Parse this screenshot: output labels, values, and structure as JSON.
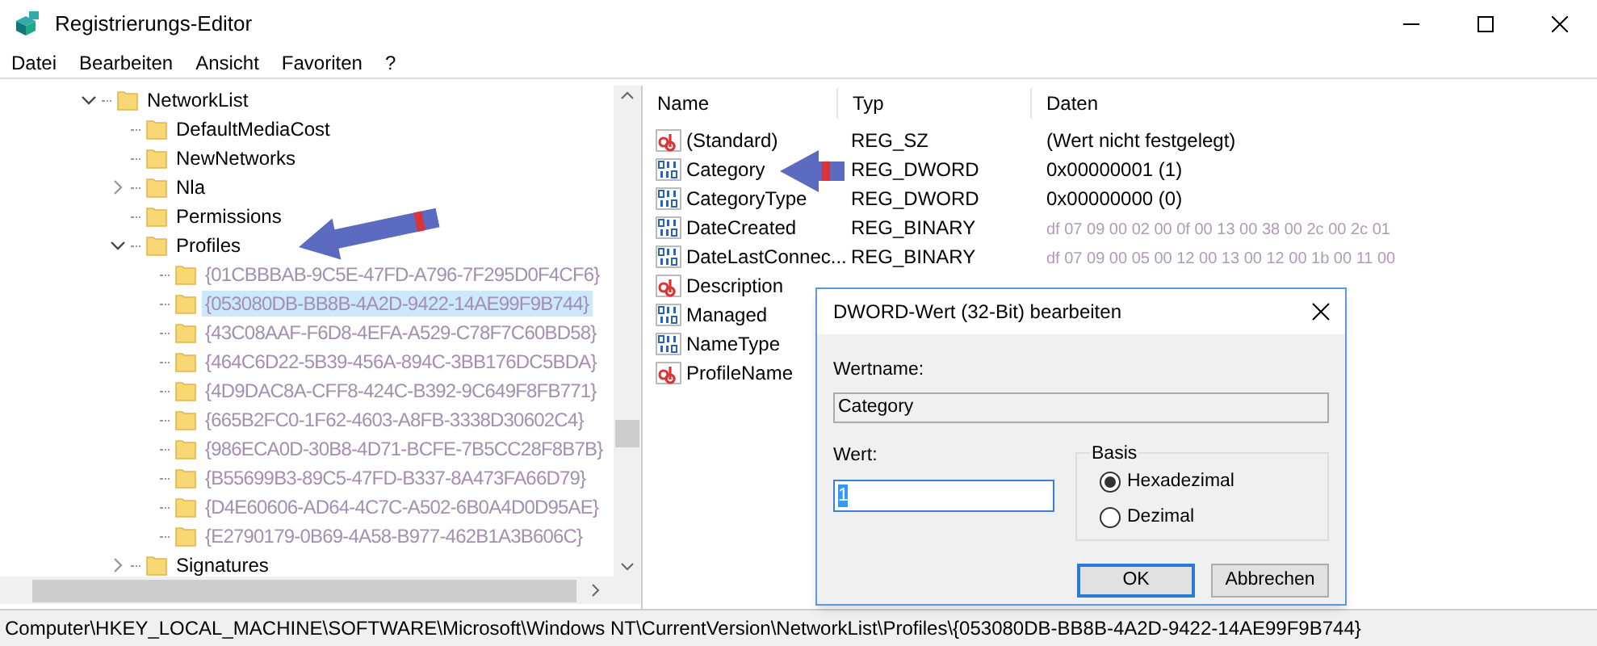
{
  "window": {
    "title": "Registrierungs-Editor"
  },
  "menu": [
    "Datei",
    "Bearbeiten",
    "Ansicht",
    "Favoriten",
    "?"
  ],
  "tree": [
    {
      "label": "NetworkList",
      "expanded": true,
      "selected": false,
      "children": [
        {
          "label": "DefaultMediaCost",
          "selected": false
        },
        {
          "label": "NewNetworks",
          "selected": false
        },
        {
          "label": "Nla",
          "expanded": false,
          "selected": false
        },
        {
          "label": "Permissions",
          "selected": false
        },
        {
          "label": "Profiles",
          "expanded": true,
          "selected": false,
          "children": [
            {
              "label": "{01CBBBAB-9C5E-47FD-A796-7F295D0F4CF6}",
              "selected": false
            },
            {
              "label": "{053080DB-BB8B-4A2D-9422-14AE99F9B744}",
              "selected": true
            },
            {
              "label": "{43C08AAF-F6D8-4EFA-A529-C78F7C60BD58}",
              "selected": false
            },
            {
              "label": "{464C6D22-5B39-456A-894C-3BB176DC5BDA}",
              "selected": false
            },
            {
              "label": "{4D9DAC8A-CFF8-424C-B392-9C649F8FB771}",
              "selected": false
            },
            {
              "label": "{665B2FC0-1F62-4603-A8FB-3338D30602C4}",
              "selected": false
            },
            {
              "label": "{986ECA0D-30B8-4D71-BCFE-7B5CC28F8B7B}",
              "selected": false
            },
            {
              "label": "{B55699B3-89C5-47FD-B337-8A473FA66D79}",
              "selected": false
            },
            {
              "label": "{D4E60606-AD64-4C7C-A502-6B0A4D0D95AE}",
              "selected": false
            },
            {
              "label": "{E2790179-0B69-4A58-B977-462B1A3B606C}",
              "selected": false
            }
          ]
        },
        {
          "label": "Signatures",
          "expanded": false,
          "selected": false
        }
      ]
    }
  ],
  "list": {
    "columns": [
      "Name",
      "Typ",
      "Daten"
    ],
    "rows": [
      {
        "kind": "string",
        "name": "(Standard)",
        "type": "REG_SZ",
        "data": "(Wert nicht festgelegt)"
      },
      {
        "kind": "binary",
        "name": "Category",
        "type": "REG_DWORD",
        "data": "0x00000001 (1)"
      },
      {
        "kind": "binary",
        "name": "CategoryType",
        "type": "REG_DWORD",
        "data": "0x00000000 (0)"
      },
      {
        "kind": "binary",
        "name": "DateCreated",
        "type": "REG_BINARY",
        "data": "df 07 09 00 02 00 0f 00 13 00 38 00 2c 00 2c 01"
      },
      {
        "kind": "binary",
        "name": "DateLastConnec...",
        "type": "REG_BINARY",
        "data": "df 07 09 00 05 00 12 00 13 00 12 00 1b 00 11 00"
      },
      {
        "kind": "string",
        "name": "Description"
      },
      {
        "kind": "binary",
        "name": "Managed"
      },
      {
        "kind": "binary",
        "name": "NameType"
      },
      {
        "kind": "string",
        "name": "ProfileName"
      }
    ]
  },
  "dialog": {
    "title": "DWORD-Wert (32-Bit) bearbeiten",
    "value_name_label": "Wertname:",
    "value_name": "Category",
    "value_label": "Wert:",
    "value": "1",
    "base": {
      "label": "Basis",
      "options": [
        {
          "label": "Hexadezimal",
          "selected": true
        },
        {
          "label": "Dezimal",
          "selected": false
        }
      ]
    },
    "buttons": [
      {
        "label": "OK",
        "default": true
      },
      {
        "label": "Abbrechen",
        "default": false
      }
    ]
  },
  "status_bar": "Computer\\HKEY_LOCAL_MACHINE\\SOFTWARE\\Microsoft\\Windows NT\\CurrentVersion\\NetworkList\\Profiles\\{053080DB-BB8B-4A2D-9422-14AE99F9B744}"
}
